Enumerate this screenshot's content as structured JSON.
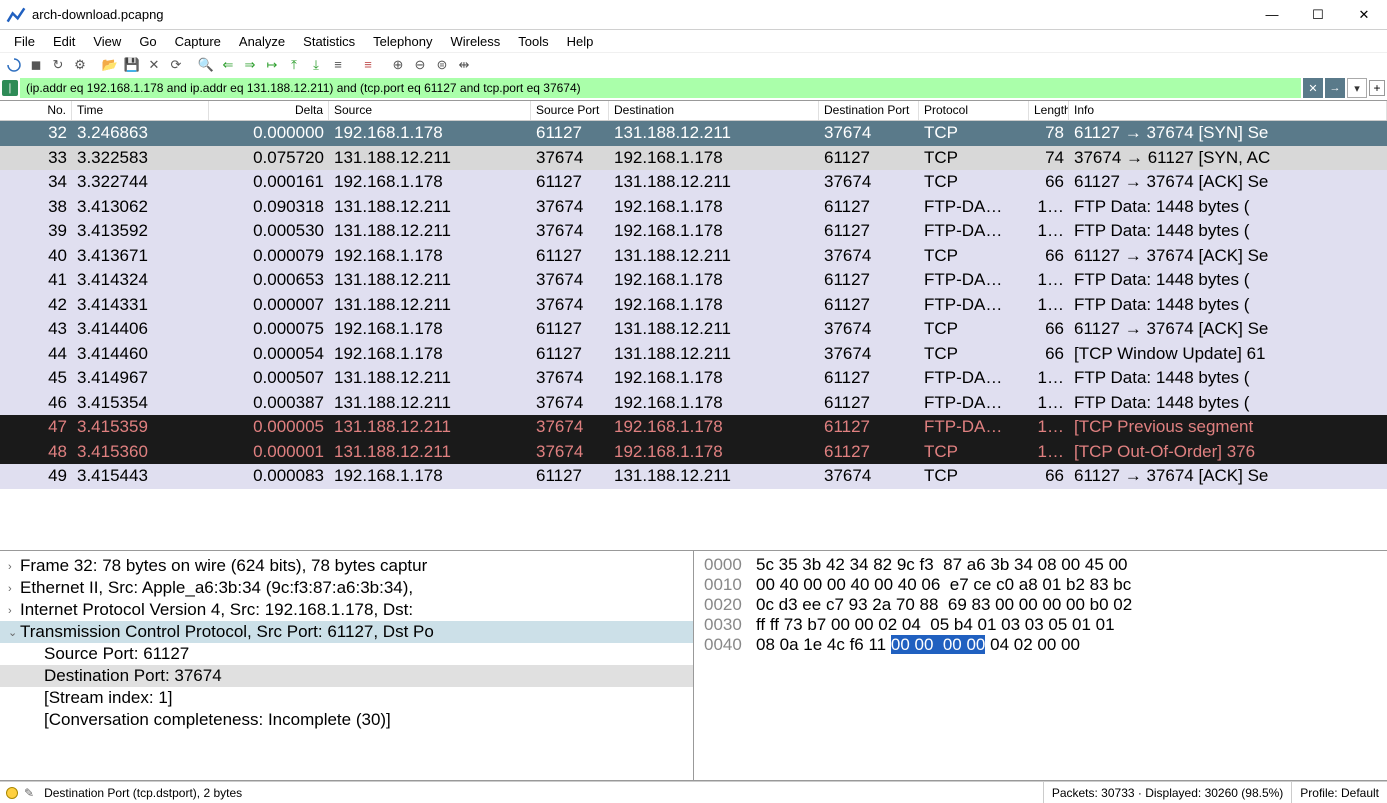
{
  "window": {
    "title": "arch-download.pcapng"
  },
  "menu": [
    "File",
    "Edit",
    "View",
    "Go",
    "Capture",
    "Analyze",
    "Statistics",
    "Telephony",
    "Wireless",
    "Tools",
    "Help"
  ],
  "filter": {
    "value": "(ip.addr eq 192.168.1.178 and ip.addr eq 131.188.12.211) and (tcp.port eq 61127 and tcp.port eq 37674)"
  },
  "columns": [
    {
      "key": "no",
      "label": "No.",
      "cls": "c-no"
    },
    {
      "key": "time",
      "label": "Time",
      "cls": "c-time"
    },
    {
      "key": "delta",
      "label": "Delta",
      "cls": "c-delta"
    },
    {
      "key": "src",
      "label": "Source",
      "cls": "c-src"
    },
    {
      "key": "sport",
      "label": "Source Port",
      "cls": "c-sport"
    },
    {
      "key": "dst",
      "label": "Destination",
      "cls": "c-dst"
    },
    {
      "key": "dport",
      "label": "Destination Port",
      "cls": "c-dport"
    },
    {
      "key": "proto",
      "label": "Protocol",
      "cls": "c-proto"
    },
    {
      "key": "len",
      "label": "Length",
      "cls": "c-len"
    },
    {
      "key": "info",
      "label": "Info",
      "cls": "c-info"
    }
  ],
  "packets": [
    {
      "no": "32",
      "time": "3.246863",
      "delta": "0.000000",
      "src": "192.168.1.178",
      "sport": "61127",
      "dst": "131.188.12.211",
      "dport": "37674",
      "proto": "TCP",
      "len": "78",
      "info": "61127 → 37674 [SYN] Se",
      "style": "selected"
    },
    {
      "no": "33",
      "time": "3.322583",
      "delta": "0.075720",
      "src": "131.188.12.211",
      "sport": "37674",
      "dst": "192.168.1.178",
      "dport": "61127",
      "proto": "TCP",
      "len": "74",
      "info": "37674 → 61127 [SYN, AC",
      "style": "bg-gray"
    },
    {
      "no": "34",
      "time": "3.322744",
      "delta": "0.000161",
      "src": "192.168.1.178",
      "sport": "61127",
      "dst": "131.188.12.211",
      "dport": "37674",
      "proto": "TCP",
      "len": "66",
      "info": "61127 → 37674 [ACK] Se",
      "style": "bg-lavender"
    },
    {
      "no": "38",
      "time": "3.413062",
      "delta": "0.090318",
      "src": "131.188.12.211",
      "sport": "37674",
      "dst": "192.168.1.178",
      "dport": "61127",
      "proto": "FTP-DA…",
      "len": "1…",
      "info": "FTP Data: 1448 bytes (",
      "style": "bg-lavender"
    },
    {
      "no": "39",
      "time": "3.413592",
      "delta": "0.000530",
      "src": "131.188.12.211",
      "sport": "37674",
      "dst": "192.168.1.178",
      "dport": "61127",
      "proto": "FTP-DA…",
      "len": "1…",
      "info": "FTP Data: 1448 bytes (",
      "style": "bg-lavender"
    },
    {
      "no": "40",
      "time": "3.413671",
      "delta": "0.000079",
      "src": "192.168.1.178",
      "sport": "61127",
      "dst": "131.188.12.211",
      "dport": "37674",
      "proto": "TCP",
      "len": "66",
      "info": "61127 → 37674 [ACK] Se",
      "style": "bg-lavender"
    },
    {
      "no": "41",
      "time": "3.414324",
      "delta": "0.000653",
      "src": "131.188.12.211",
      "sport": "37674",
      "dst": "192.168.1.178",
      "dport": "61127",
      "proto": "FTP-DA…",
      "len": "1…",
      "info": "FTP Data: 1448 bytes (",
      "style": "bg-lavender"
    },
    {
      "no": "42",
      "time": "3.414331",
      "delta": "0.000007",
      "src": "131.188.12.211",
      "sport": "37674",
      "dst": "192.168.1.178",
      "dport": "61127",
      "proto": "FTP-DA…",
      "len": "1…",
      "info": "FTP Data: 1448 bytes (",
      "style": "bg-lavender"
    },
    {
      "no": "43",
      "time": "3.414406",
      "delta": "0.000075",
      "src": "192.168.1.178",
      "sport": "61127",
      "dst": "131.188.12.211",
      "dport": "37674",
      "proto": "TCP",
      "len": "66",
      "info": "61127 → 37674 [ACK] Se",
      "style": "bg-lavender"
    },
    {
      "no": "44",
      "time": "3.414460",
      "delta": "0.000054",
      "src": "192.168.1.178",
      "sport": "61127",
      "dst": "131.188.12.211",
      "dport": "37674",
      "proto": "TCP",
      "len": "66",
      "info": "[TCP Window Update] 61",
      "style": "bg-lavender"
    },
    {
      "no": "45",
      "time": "3.414967",
      "delta": "0.000507",
      "src": "131.188.12.211",
      "sport": "37674",
      "dst": "192.168.1.178",
      "dport": "61127",
      "proto": "FTP-DA…",
      "len": "1…",
      "info": "FTP Data: 1448 bytes (",
      "style": "bg-lavender"
    },
    {
      "no": "46",
      "time": "3.415354",
      "delta": "0.000387",
      "src": "131.188.12.211",
      "sport": "37674",
      "dst": "192.168.1.178",
      "dport": "61127",
      "proto": "FTP-DA…",
      "len": "1…",
      "info": "FTP Data: 1448 bytes (",
      "style": "bg-lavender"
    },
    {
      "no": "47",
      "time": "3.415359",
      "delta": "0.000005",
      "src": "131.188.12.211",
      "sport": "37674",
      "dst": "192.168.1.178",
      "dport": "61127",
      "proto": "FTP-DA…",
      "len": "1…",
      "info": "[TCP Previous segment ",
      "style": "bg-dark"
    },
    {
      "no": "48",
      "time": "3.415360",
      "delta": "0.000001",
      "src": "131.188.12.211",
      "sport": "37674",
      "dst": "192.168.1.178",
      "dport": "61127",
      "proto": "TCP",
      "len": "1…",
      "info": "[TCP Out-Of-Order] 376",
      "style": "bg-dark"
    },
    {
      "no": "49",
      "time": "3.415443",
      "delta": "0.000083",
      "src": "192.168.1.178",
      "sport": "61127",
      "dst": "131.188.12.211",
      "dport": "37674",
      "proto": "TCP",
      "len": "66",
      "info": "61127 → 37674 [ACK] Se",
      "style": "bg-lavender"
    }
  ],
  "tree": [
    {
      "text": "Frame 32: 78 bytes on wire (624 bits), 78 bytes captur",
      "exp": ">",
      "depth": 0
    },
    {
      "text": "Ethernet II, Src: Apple_a6:3b:34 (9c:f3:87:a6:3b:34),",
      "exp": ">",
      "depth": 0
    },
    {
      "text": "Internet Protocol Version 4, Src: 192.168.1.178, Dst:",
      "exp": ">",
      "depth": 0
    },
    {
      "text": "Transmission Control Protocol, Src Port: 61127, Dst Po",
      "exp": "v",
      "depth": 0,
      "sel": true
    },
    {
      "text": "Source Port: 61127",
      "exp": "",
      "depth": 1
    },
    {
      "text": "Destination Port: 37674",
      "exp": "",
      "depth": 1,
      "hl": true
    },
    {
      "text": "[Stream index: 1]",
      "exp": "",
      "depth": 1
    },
    {
      "text": "[Conversation completeness: Incomplete (30)]",
      "exp": "",
      "depth": 1
    }
  ],
  "hex": [
    {
      "off": "0000",
      "b": "5c 35 3b 42 34 82 9c f3  87 a6 3b 34 08 00 45 00"
    },
    {
      "off": "0010",
      "b": "00 40 00 00 40 00 40 06  e7 ce c0 a8 01 b2 83 bc"
    },
    {
      "off": "0020",
      "b": "0c d3 ee c7 93 2a 70 88  69 83 00 00 00 00 b0 02"
    },
    {
      "off": "0030",
      "b": "ff ff 73 b7 00 00 02 04  05 b4 01 03 03 05 01 01"
    },
    {
      "off": "0040",
      "b": "08 0a 1e 4c f6 11 ",
      "sel": "00 00  00 00",
      "post": " 04 02 00 00"
    }
  ],
  "status": {
    "left": "Destination Port (tcp.dstport), 2 bytes",
    "packets": "Packets: 30733 · Displayed: 30260 (98.5%)",
    "profile": "Profile: Default"
  }
}
